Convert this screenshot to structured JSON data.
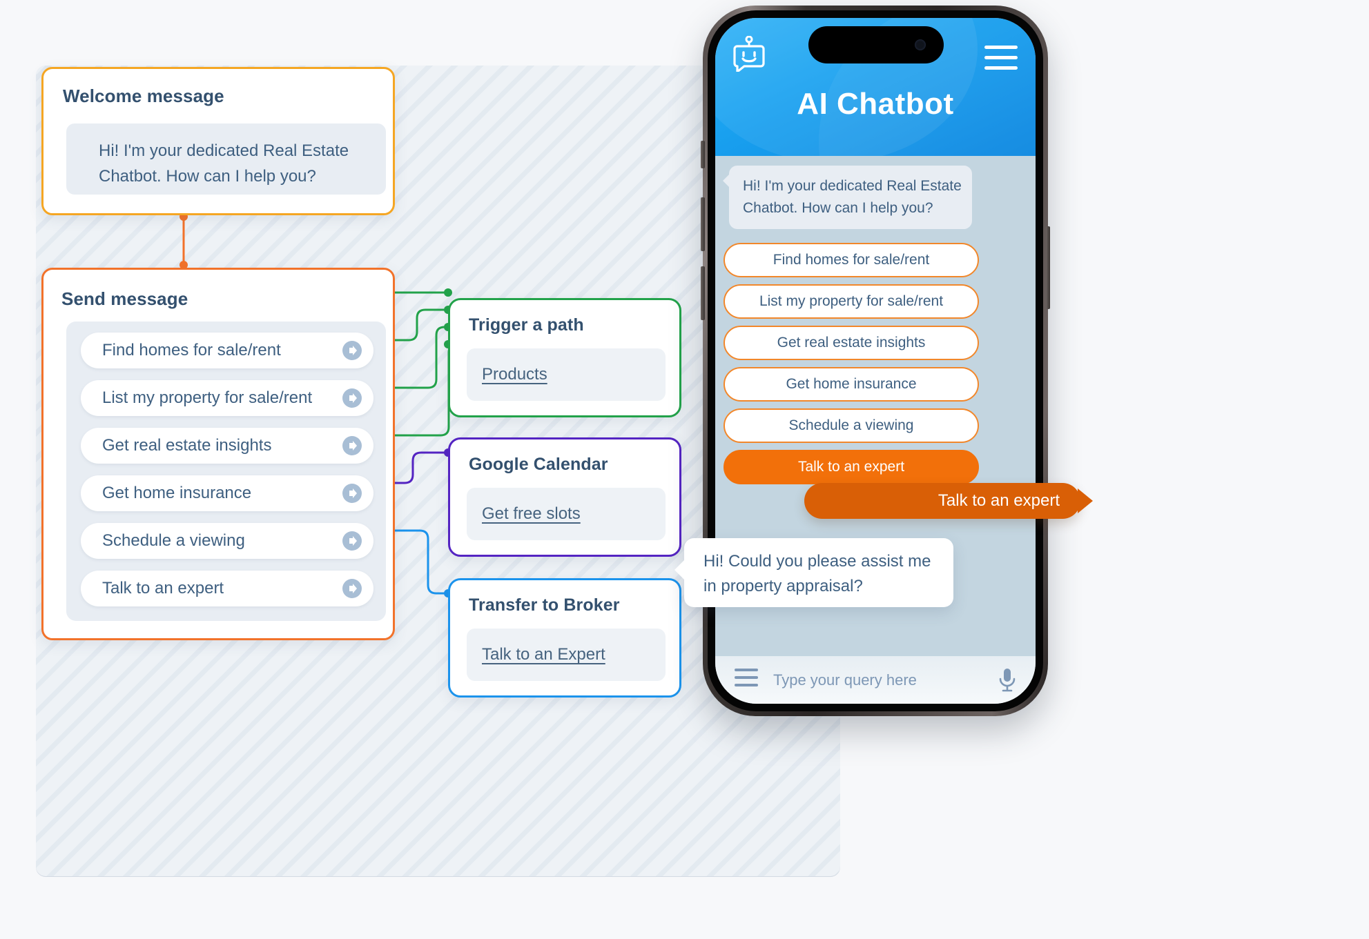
{
  "builder": {
    "welcome_node": {
      "title": "Welcome message",
      "message": "Hi! I'm your dedicated Real Estate Chatbot. How can I help you?",
      "accent_color": "#F5A623"
    },
    "send_node": {
      "title": "Send message",
      "accent_color": "#F2722A",
      "options": [
        {
          "label": "Find homes for sale/rent",
          "icon": "arrow-right-circle-icon"
        },
        {
          "label": "List my property for sale/rent",
          "icon": "arrow-right-circle-icon"
        },
        {
          "label": "Get real estate insights",
          "icon": "arrow-right-circle-icon"
        },
        {
          "label": "Get home insurance",
          "icon": "arrow-right-circle-icon"
        },
        {
          "label": "Schedule a viewing",
          "icon": "arrow-right-circle-icon"
        },
        {
          "label": "Talk to an expert",
          "icon": "arrow-right-circle-icon"
        }
      ]
    },
    "action_nodes": [
      {
        "title": "Trigger a path",
        "field": "Products",
        "accent_color": "#22A24A"
      },
      {
        "title": "Google Calendar",
        "field": "Get free slots",
        "accent_color": "#5424C2"
      },
      {
        "title": "Transfer to Broker",
        "field": "Talk to an Expert",
        "accent_color": "#1B93EC"
      }
    ]
  },
  "phone": {
    "app_title": "AI Chatbot",
    "bot_icon": "robot-chat-icon",
    "menu_icon": "hamburger-menu-icon",
    "bot_message": "Hi! I'm your dedicated Real Estate Chatbot. How can I help you?",
    "quick_replies": [
      {
        "label": "Find homes for sale/rent",
        "style": "outline"
      },
      {
        "label": "List my property for sale/rent",
        "style": "outline"
      },
      {
        "label": "Get real estate insights",
        "style": "outline"
      },
      {
        "label": "Get home insurance",
        "style": "outline"
      },
      {
        "label": "Schedule a viewing",
        "style": "outline"
      },
      {
        "label": "Talk to an expert",
        "style": "filled"
      }
    ],
    "user_message": "Talk to an expert",
    "bot_followup": "Hi! Could you please assist me in property appraisal?",
    "input": {
      "menu_icon": "hamburger-menu-icon",
      "placeholder": "Type your query here",
      "mic_icon": "microphone-icon"
    },
    "colors": {
      "header": "#1AA2F0",
      "chat_background": "#C3D5E0",
      "accent": "#F2700A",
      "user_bubble": "#D95F06"
    }
  },
  "overflow": {
    "user_message": "Talk to an expert",
    "bot_message": "Hi! Could you please assist me in property appraisal?"
  }
}
